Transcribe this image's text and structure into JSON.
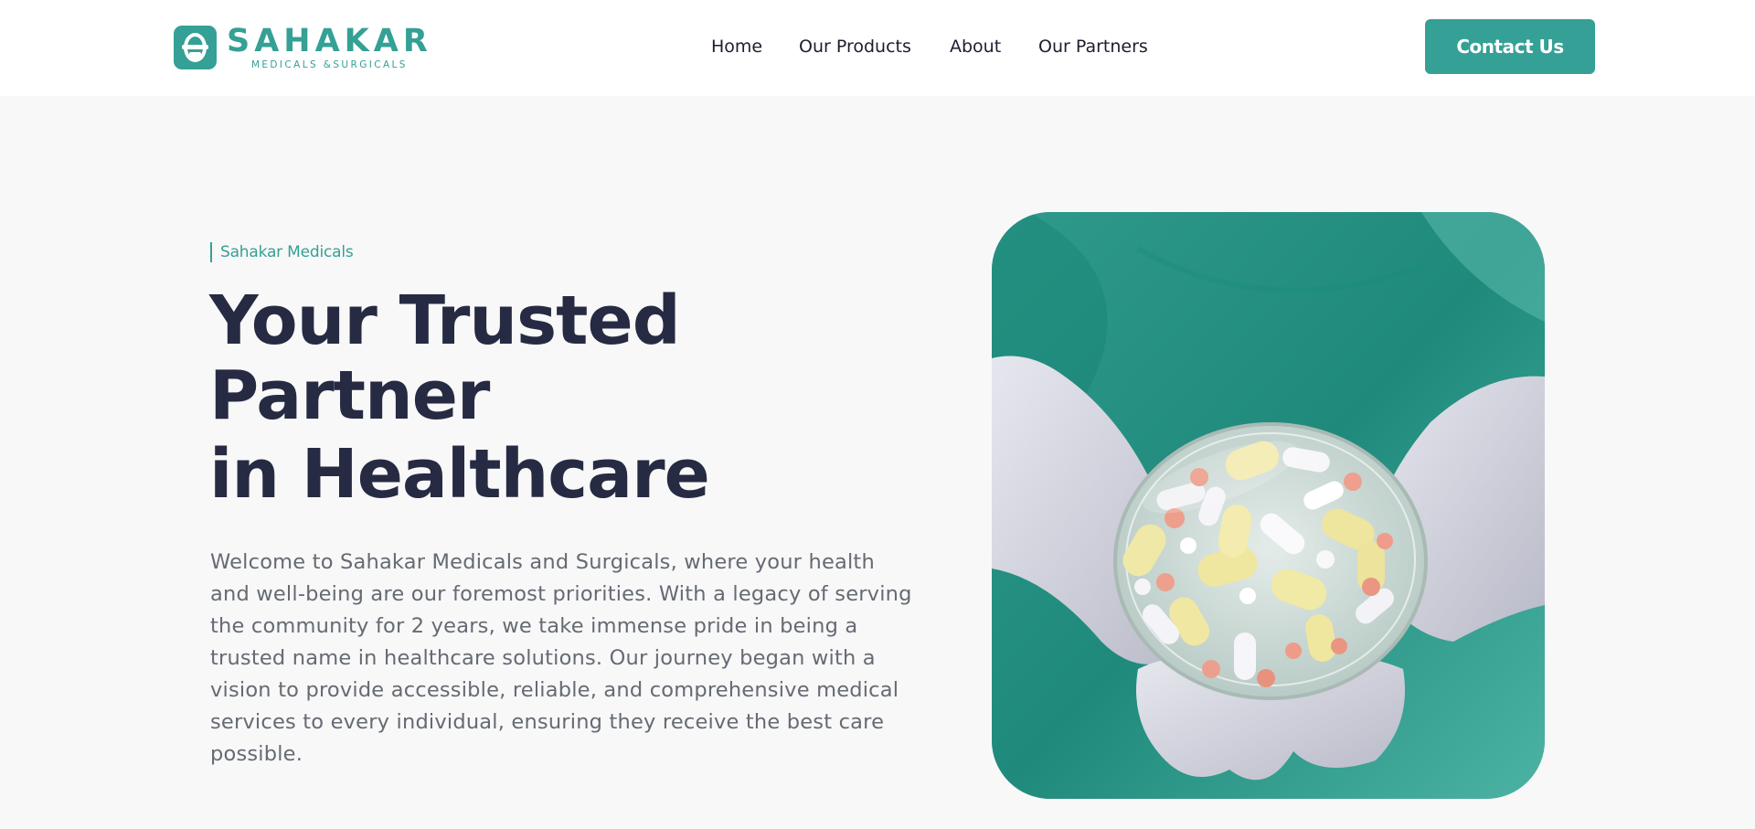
{
  "brand": {
    "name": "SAHAKAR",
    "tagline": "MEDICALS &SURGICALS"
  },
  "nav": {
    "items": [
      "Home",
      "Our Products",
      "About",
      "Our Partners"
    ]
  },
  "header": {
    "contact_label": "Contact Us"
  },
  "hero": {
    "eyebrow": "Sahakar Medicals",
    "headline_lines": [
      "Your Trusted",
      "Partner",
      "in Healthcare"
    ],
    "intro_lines": [
      "Welcome to Sahakar Medicals and Surgicals, where your health",
      "and well-being are our foremost priorities. With a legacy of serving",
      "the community for 2 years, we take immense pride in being a",
      "trusted name in healthcare solutions. Our journey began with a",
      "vision to provide accessible, reliable, and comprehensive medical",
      "services to every individual, ensuring they receive the best care",
      "possible."
    ],
    "image_subject": "gloved hands holding a glass dish of assorted pills"
  },
  "colors": {
    "accent": "#35a095",
    "heading": "#262b43",
    "body_text": "#656a73",
    "page_bg": "#f8f8f8",
    "header_bg": "#ffffff"
  },
  "icons": {
    "logo": "caduceus-badge-icon"
  }
}
